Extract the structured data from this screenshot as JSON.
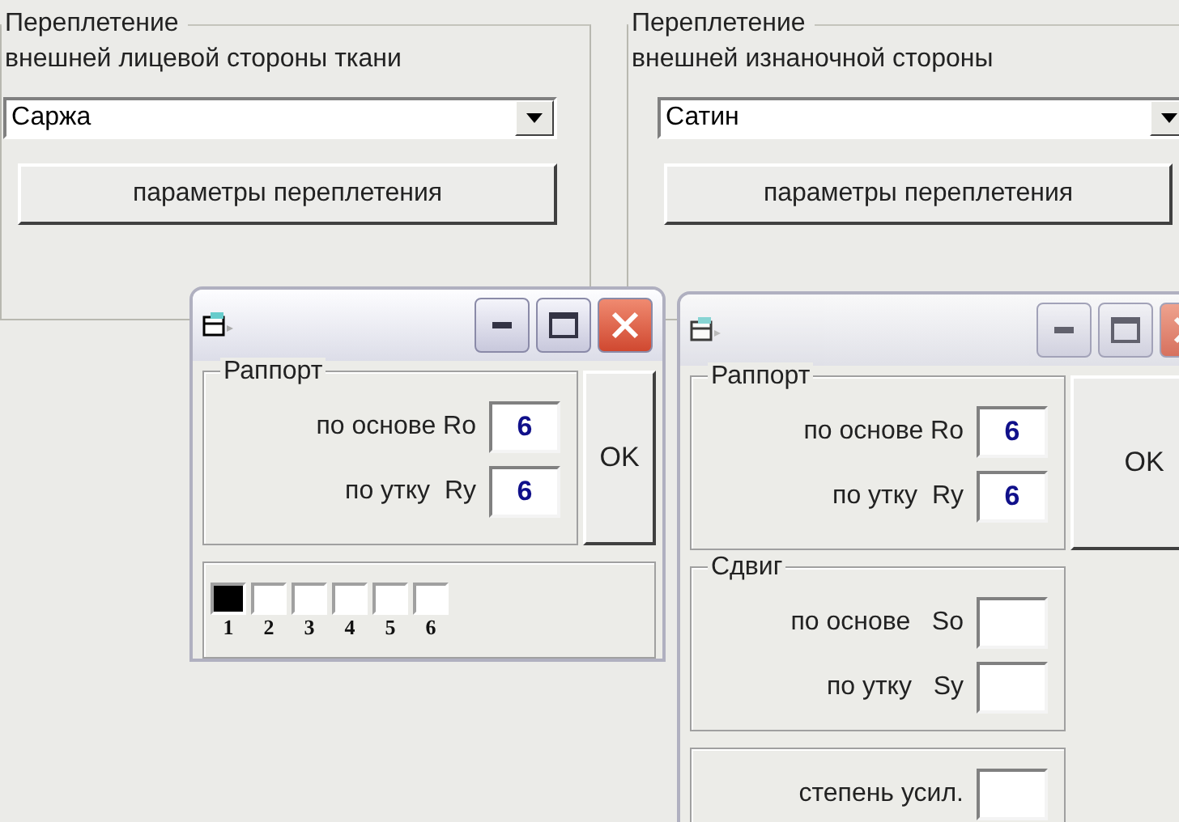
{
  "panels": [
    {
      "legend": "Переплетение",
      "subtitle": "внешней лицевой стороны ткани",
      "combo_value": "Саржа",
      "button": "параметры переплетения"
    },
    {
      "legend": "Переплетение",
      "subtitle": "внешней изнаночной  стороны",
      "combo_value": "Сатин",
      "button": "параметры переплетения"
    }
  ],
  "dialogs": [
    {
      "active": true,
      "ok": "OK",
      "groups": [
        {
          "kind": "fields",
          "legend": "Раппорт",
          "fields": [
            {
              "label": "по основе Ro",
              "value": "6"
            },
            {
              "label": "по утку  Ry",
              "value": "6"
            }
          ]
        },
        {
          "kind": "cells",
          "cells": [
            {
              "label": "1",
              "filled": true
            },
            {
              "label": "2",
              "filled": false
            },
            {
              "label": "3",
              "filled": false
            },
            {
              "label": "4",
              "filled": false
            },
            {
              "label": "5",
              "filled": false
            },
            {
              "label": "6",
              "filled": false
            }
          ]
        }
      ]
    },
    {
      "active": false,
      "ok": "OK",
      "groups": [
        {
          "kind": "fields",
          "legend": "Раппорт",
          "fields": [
            {
              "label": "по основе Ro",
              "value": "6"
            },
            {
              "label": "по утку  Ry",
              "value": "6"
            }
          ]
        },
        {
          "kind": "fields",
          "legend": "Сдвиг",
          "fields": [
            {
              "label": "по основе   So"
            },
            {
              "label": "по утку   Sy"
            }
          ]
        },
        {
          "kind": "fields",
          "fields": [
            {
              "label": "степень усил."
            }
          ]
        }
      ]
    }
  ]
}
